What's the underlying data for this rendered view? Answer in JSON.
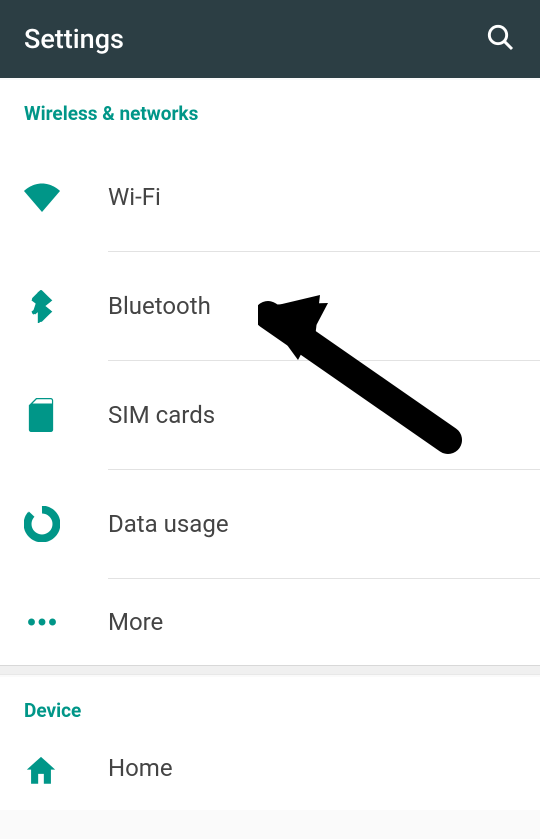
{
  "header": {
    "title": "Settings"
  },
  "sections": {
    "wireless": {
      "label": "Wireless & networks",
      "items": {
        "wifi": "Wi-Fi",
        "bluetooth": "Bluetooth",
        "sim": "SIM cards",
        "data": "Data usage",
        "more": "More"
      }
    },
    "device": {
      "label": "Device",
      "items": {
        "home": "Home"
      }
    }
  },
  "colors": {
    "accent": "#009688",
    "headerBg": "#2c3e44"
  }
}
